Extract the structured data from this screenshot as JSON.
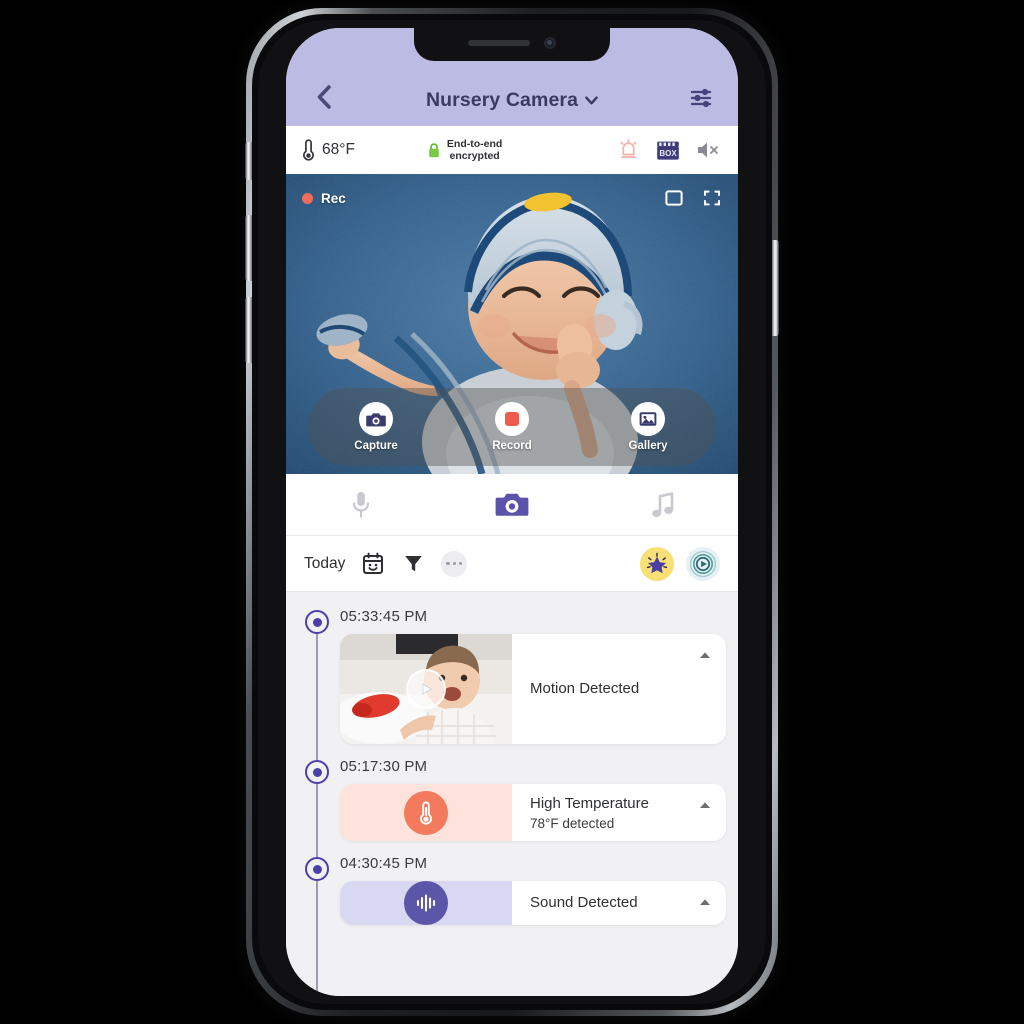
{
  "header": {
    "back_icon": "chevron-left-icon",
    "title": "Nursery Camera",
    "caret_icon": "chevron-down-icon",
    "settings_icon": "sliders-settings-icon",
    "bg_color": "#bbbbe4",
    "title_color": "#3b3a63"
  },
  "status_bar": {
    "temp_icon": "thermometer-icon",
    "temperature": "68°F",
    "lock_icon": "lock-icon",
    "lock_color": "#7ac943",
    "encryption_line1": "End-to-end",
    "encryption_line2": "encrypted",
    "alarm_icon": "alarm-siren-icon",
    "alarm_color": "#f4b9b2",
    "clapper_icon": "movie-clapper-icon",
    "clapper_color": "#3d3b7a",
    "mute_icon": "speaker-muted-icon",
    "mute_color": "#8a8a92"
  },
  "video": {
    "rec_label": "Rec",
    "rec_dot_color": "#ef6d5c",
    "pip_icon": "picture-in-picture-icon",
    "fullscreen_icon": "fullscreen-expand-icon",
    "controls": [
      {
        "label": "Capture",
        "icon": "camera-icon"
      },
      {
        "label": "Record",
        "icon": "record-dot-icon"
      },
      {
        "label": "Gallery",
        "icon": "image-gallery-icon"
      }
    ]
  },
  "mode_tabs": [
    {
      "name": "microphone",
      "icon": "microphone-icon",
      "active": false,
      "color": "#c4c4cc"
    },
    {
      "name": "camera",
      "icon": "camera-icon",
      "active": true,
      "color": "#5b53ab"
    },
    {
      "name": "lullaby",
      "icon": "music-note-icon",
      "active": false,
      "color": "#c4c4cc"
    }
  ],
  "filter_bar": {
    "today_label": "Today",
    "calendar_icon": "calendar-smiley-icon",
    "filter_icon": "funnel-filter-icon",
    "more_icon": "more-horizontal-icon",
    "star_icon": "sparkle-star-icon",
    "star_bg": "#f7e075",
    "live_icon": "live-play-target-icon",
    "live_bg": "#e3f1f2"
  },
  "events": [
    {
      "time": "05:33:45 PM",
      "title": "Motion Detected",
      "subtitle": "",
      "type": "video",
      "thumb_play_icon": "play-icon",
      "caret_icon": "caret-up-icon"
    },
    {
      "time": "05:17:30 PM",
      "title": "High Temperature",
      "subtitle": "78°F  detected",
      "type": "temp",
      "icon": "thermometer-icon",
      "caret_icon": "caret-up-icon"
    },
    {
      "time": "04:30:45 PM",
      "title": "Sound Detected",
      "subtitle": "",
      "type": "sound",
      "icon": "sound-waveform-icon",
      "caret_icon": "caret-up-icon"
    }
  ]
}
